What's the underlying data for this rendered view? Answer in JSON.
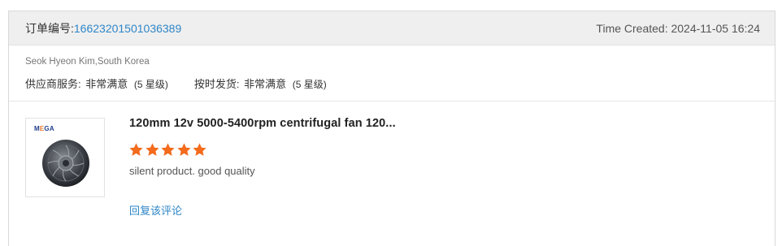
{
  "order": {
    "label": "订单编号:",
    "number": "16623201501036389",
    "time_created": "Time Created: 2024-11-05 16:24"
  },
  "buyer": {
    "name_country": "Seok Hyeon Kim,South Korea"
  },
  "ratings": [
    {
      "label": "供应商服务:",
      "value": "非常满意",
      "level": "(5 星级)"
    },
    {
      "label": "按时发货:",
      "value": "非常满意",
      "level": "(5 星级)"
    }
  ],
  "review": {
    "product_title": "120mm 12v 5000-5400rpm centrifugal fan 120...",
    "stars": 5,
    "star_color": "#f36b1c",
    "comment": "silent product. good quality",
    "reply_link": "回复该评论",
    "thumbnail_logo": "MEGA"
  },
  "colors": {
    "link": "#2e86c8",
    "header_bg": "#efefef"
  }
}
